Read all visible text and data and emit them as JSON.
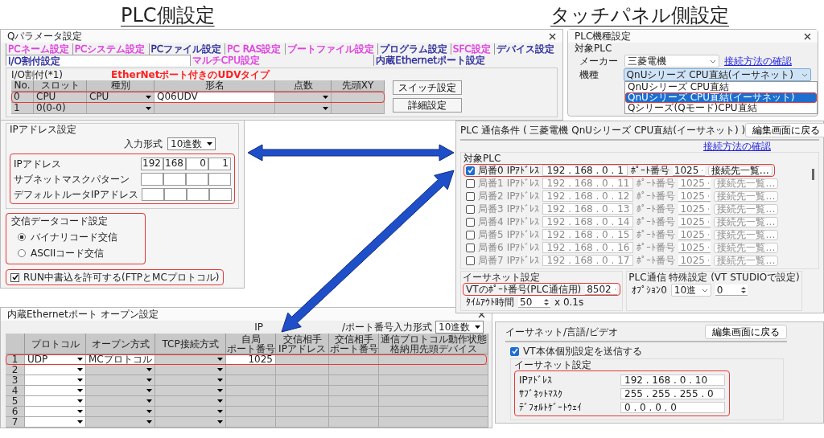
{
  "headings": [
    "PLC側設定",
    "タッチパネル側設定"
  ],
  "q_parameter_window": {
    "title": "Qパラメータ設定",
    "tab_rows": [
      [
        {
          "label": "PCネーム設定",
          "color": "#e03ce0",
          "selected": false
        },
        {
          "label": "PCシステム設定",
          "color": "#e03ce0",
          "selected": false
        },
        {
          "label": "PCファイル設定",
          "color": "#2a2a9a",
          "selected": false
        },
        {
          "label": "PC RAS設定",
          "color": "#e03ce0",
          "selected": false
        },
        {
          "label": "ブートファイル設定",
          "color": "#e03ce0",
          "selected": false
        },
        {
          "label": "プログラム設定",
          "color": "#2a2a9a",
          "selected": false
        },
        {
          "label": "SFC設定",
          "color": "#e03ce0",
          "selected": false
        },
        {
          "label": "デバイス設定",
          "color": "#2a2a9a",
          "selected": false
        }
      ],
      [
        {
          "label": "I/O割付設定",
          "color": "#2a2a9a",
          "selected": true
        },
        {
          "label": "マルチCPU設定",
          "color": "#e03ce0",
          "selected": false
        },
        {
          "label": "内蔵Ethernetポート設定",
          "color": "#2a2a9a",
          "selected": false
        }
      ]
    ],
    "group": "I/O割付(*1)",
    "annotation": "EtherNetポート付きのUDVタイプ",
    "columns": [
      {
        "label": "No.",
        "dropdown": false
      },
      {
        "label": "スロット",
        "dropdown": false
      },
      {
        "label": "種別",
        "dropdown": true
      },
      {
        "label": "形名",
        "dropdown": false
      },
      {
        "label": "点数",
        "dropdown": true
      },
      {
        "label": "先頭XY",
        "dropdown": false
      }
    ],
    "rows": [
      {
        "cells": [
          "0",
          "CPU",
          "CPU",
          "Q06UDV"
        ],
        "highlighted": true
      },
      {
        "cells": [
          "1",
          "0(0-0)"
        ],
        "highlighted": false
      }
    ],
    "buttons": [
      "スイッチ設定",
      "詳細設定"
    ]
  },
  "ip_settings": {
    "group": "IPアドレス設定",
    "input_format_label": "入力形式",
    "input_format": "10進数",
    "highlighted": true,
    "fields": [
      {
        "label": "IPアドレス",
        "octets": [
          "192",
          "168",
          "0",
          "1"
        ]
      },
      {
        "label": "サブネットマスクパターン"
      },
      {
        "label": "デフォルトルータIPアドレス"
      }
    ]
  },
  "code_settings": {
    "group": "交信データコード設定",
    "highlighted": true,
    "options": [
      {
        "label": "バイナリコード交信",
        "selected": true
      },
      {
        "label": "ASCIIコード交信",
        "selected": false
      }
    ]
  },
  "run_write": {
    "label": "RUN中書込を許可する(FTPとMCプロトコル)",
    "checked": true,
    "highlighted": true
  },
  "open_settings_window": {
    "title": "内蔵Ethernetポート オープン設定",
    "format_label_parts": [
      "IP",
      "/ポート番号入力形式"
    ],
    "format": "10進数",
    "columns": [
      {
        "lines": [
          "プロトコル"
        ],
        "dropdown": true,
        "editable": true
      },
      {
        "lines": [
          "オープン方式"
        ],
        "dropdown": true,
        "editable": false
      },
      {
        "lines": [
          "TCP接続方式"
        ],
        "dropdown": true,
        "editable": false
      },
      {
        "lines": [
          "自局",
          "ポート番号"
        ],
        "dropdown": false,
        "editable": false
      },
      {
        "lines": [
          "交信相手",
          "IPアドレス"
        ],
        "dropdown": false,
        "editable": false
      },
      {
        "lines": [
          "交信相手",
          "ポート番号"
        ],
        "dropdown": false,
        "editable": false
      },
      {
        "lines": [
          "通信プロトコル動作状態",
          "格納用先頭デバイス"
        ],
        "dropdown": false,
        "editable": false
      }
    ],
    "rows": [
      {
        "no": "1",
        "cells": [
          "UDP",
          "MCプロトコル",
          null,
          "1025"
        ],
        "highlighted": true
      },
      {
        "no": "2",
        "cells": [],
        "highlighted": false
      },
      {
        "no": "3",
        "cells": [],
        "highlighted": false
      },
      {
        "no": "4",
        "cells": [],
        "highlighted": false
      },
      {
        "no": "5",
        "cells": [],
        "highlighted": false
      },
      {
        "no": "6",
        "cells": [],
        "highlighted": false
      },
      {
        "no": "7",
        "cells": [],
        "highlighted": false
      }
    ]
  },
  "plc_model_window": {
    "title": "PLC機種設定",
    "group": "対象PLC",
    "maker_label": "メーカー",
    "maker": "三菱電機",
    "link": "接続方法の確認",
    "model_label": "機種",
    "model": "QnUシリーズ CPU直結(イーサネット)",
    "options": [
      {
        "label": "QnUシリーズ CPU直結",
        "selected": false,
        "highlighted": false
      },
      {
        "label": "QnUシリーズ CPU直結(イーサネット)",
        "selected": true,
        "highlighted": true
      },
      {
        "label": "Qシリーズ(Qモード)CPU直結",
        "selected": false,
        "highlighted": false
      }
    ]
  },
  "comm_window": {
    "title": "PLC 通信条件 ( 三菱電機 QnUシリーズ CPU直結(イーサネット) )",
    "back_button": "編集画面に戻る",
    "link": "接続方法の確認",
    "group": "対象PLC",
    "stations": [
      {
        "label": "局番0",
        "checked": true,
        "highlighted": true,
        "ip_label": "IPｱﾄﾞﾚｽ",
        "ip": "192 . 168 . 0 . 1",
        "port_label": "ﾎﾟｰﾄ番号",
        "port": "1025",
        "button": "接続先一覧…"
      },
      {
        "label": "局番1",
        "checked": false,
        "highlighted": false,
        "ip_label": "IPｱﾄﾞﾚｽ",
        "ip": "192 . 168 . 0 . 11",
        "port_label": "ﾎﾟｰﾄ番号",
        "port": "1025",
        "button": "接続先一覧…"
      },
      {
        "label": "局番2",
        "checked": false,
        "highlighted": false,
        "ip_label": "IPｱﾄﾞﾚｽ",
        "ip": "192 . 168 . 0 . 12",
        "port_label": "ﾎﾟｰﾄ番号",
        "port": "1025",
        "button": "接続先一覧…"
      },
      {
        "label": "局番3",
        "checked": false,
        "highlighted": false,
        "ip_label": "IPｱﾄﾞﾚｽ",
        "ip": "192 . 168 . 0 . 13",
        "port_label": "ﾎﾟｰﾄ番号",
        "port": "1025",
        "button": "接続先一覧…"
      },
      {
        "label": "局番4",
        "checked": false,
        "highlighted": false,
        "ip_label": "IPｱﾄﾞﾚｽ",
        "ip": "192 . 168 . 0 . 14",
        "port_label": "ﾎﾟｰﾄ番号",
        "port": "1025",
        "button": "接続先一覧…"
      },
      {
        "label": "局番5",
        "checked": false,
        "highlighted": false,
        "ip_label": "IPｱﾄﾞﾚｽ",
        "ip": "192 . 168 . 0 . 15",
        "port_label": "ﾎﾟｰﾄ番号",
        "port": "1025",
        "button": "接続先一覧…"
      },
      {
        "label": "局番6",
        "checked": false,
        "highlighted": false,
        "ip_label": "IPｱﾄﾞﾚｽ",
        "ip": "192 . 168 . 0 . 16",
        "port_label": "ﾎﾟｰﾄ番号",
        "port": "1025",
        "button": "接続先一覧…"
      },
      {
        "label": "局番7",
        "checked": false,
        "highlighted": false,
        "ip_label": "IPｱﾄﾞﾚｽ",
        "ip": "192 . 168 . 0 . 17",
        "port_label": "ﾎﾟｰﾄ番号",
        "port": "1025",
        "button": "接続先一覧…"
      }
    ],
    "ethernet": {
      "group": "イーサネット設定",
      "vt_port_label": "VTのﾎﾟｰﾄ番号(PLC通信用)",
      "vt_port": "8502",
      "vt_port_highlighted": true,
      "timeout_label": "ﾀｲﾑｱｳﾄ時間",
      "timeout": "50",
      "timeout_unit": "x 0.1s"
    },
    "special": {
      "group": "PLC通信 特殊設定 (VT STUDIOで設定)",
      "option_label": "ｵﾌﾟｼｮﾝ0",
      "option_format": "10進",
      "option_value": "0"
    }
  },
  "ethernet_window": {
    "title": "イーサネット/言語/ビデオ",
    "back_button": "編集画面に戻る",
    "send_checkbox": {
      "label": "VT本体個別設定を送信する",
      "checked": true
    },
    "group": "イーサネット設定",
    "highlighted": true,
    "fields": [
      {
        "label": "IPｱﾄﾞﾚｽ",
        "value": "192 . 168 . 0 . 10"
      },
      {
        "label": "ｻﾌﾞﾈｯﾄﾏｽｸ",
        "value": "255 . 255 . 255 . 0"
      },
      {
        "label": "ﾃﾞﾌｫﾙﾄｹﾞｰﾄｳｪｲ",
        "value": "0 . 0 . 0 . 0"
      }
    ]
  }
}
